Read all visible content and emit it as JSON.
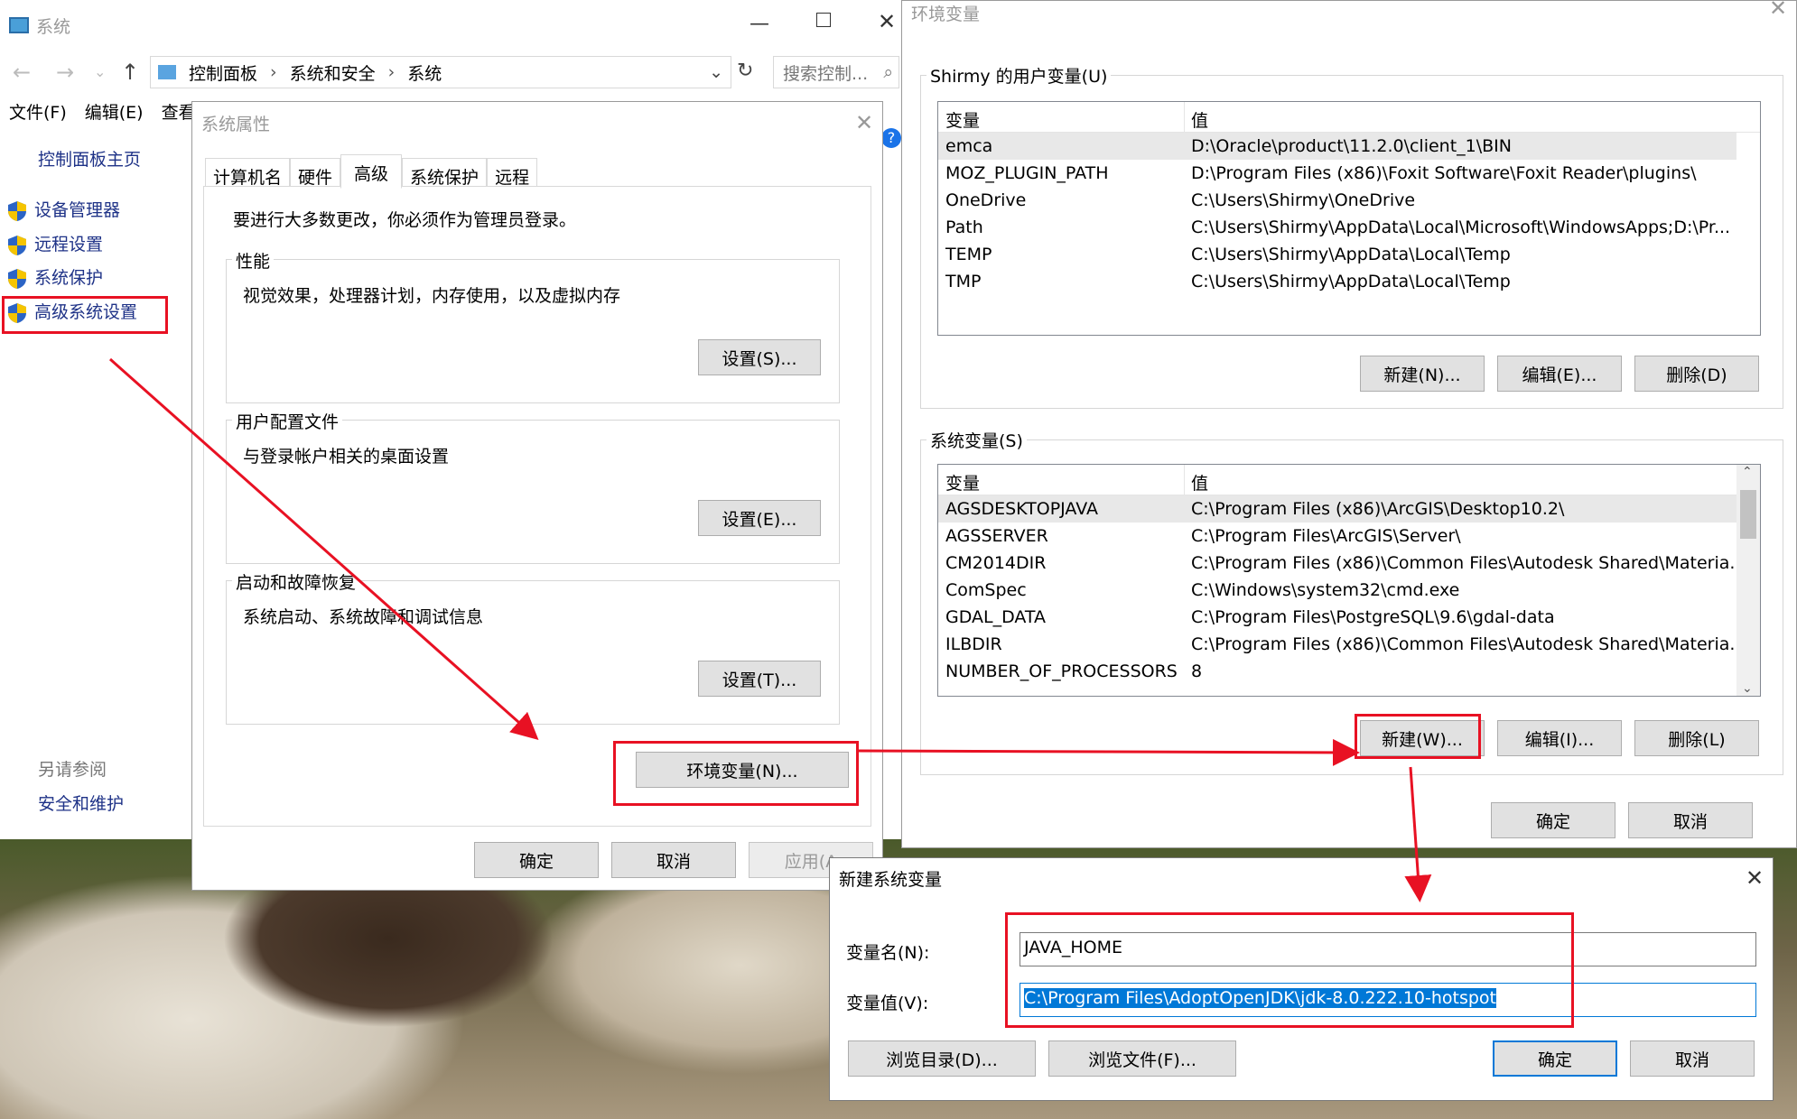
{
  "system_window": {
    "title": "系统",
    "address": [
      "控制面板",
      "系统和安全",
      "系统"
    ],
    "search_placeholder": "搜索控制...",
    "menu": [
      "文件(F)",
      "编辑(E)",
      "查看("
    ],
    "home_link": "控制面板主页",
    "links": [
      "设备管理器",
      "远程设置",
      "系统保护",
      "高级系统设置"
    ],
    "see_also_title": "另请参阅",
    "see_also": "安全和维护"
  },
  "sysprops": {
    "title": "系统属性",
    "tabs": [
      "计算机名",
      "硬件",
      "高级",
      "系统保护",
      "远程"
    ],
    "admin_note": "要进行大多数更改，你必须作为管理员登录。",
    "perf": {
      "title": "性能",
      "desc": "视觉效果，处理器计划，内存使用，以及虚拟内存",
      "button": "设置(S)..."
    },
    "profile": {
      "title": "用户配置文件",
      "desc": "与登录帐户相关的桌面设置",
      "button": "设置(E)..."
    },
    "startup": {
      "title": "启动和故障恢复",
      "desc": "系统启动、系统故障和调试信息",
      "button": "设置(T)..."
    },
    "env_button": "环境变量(N)...",
    "ok": "确定",
    "cancel": "取消",
    "apply": "应用(A"
  },
  "envvars": {
    "title": "环境变量",
    "user_group": "Shirmy 的用户变量(U)",
    "col_var": "变量",
    "col_val": "值",
    "user_vars": [
      {
        "name": "emca",
        "value": "D:\\Oracle\\product\\11.2.0\\client_1\\BIN"
      },
      {
        "name": "MOZ_PLUGIN_PATH",
        "value": "D:\\Program Files (x86)\\Foxit Software\\Foxit Reader\\plugins\\"
      },
      {
        "name": "OneDrive",
        "value": "C:\\Users\\Shirmy\\OneDrive"
      },
      {
        "name": "Path",
        "value": "C:\\Users\\Shirmy\\AppData\\Local\\Microsoft\\WindowsApps;D:\\Pr..."
      },
      {
        "name": "TEMP",
        "value": "C:\\Users\\Shirmy\\AppData\\Local\\Temp"
      },
      {
        "name": "TMP",
        "value": "C:\\Users\\Shirmy\\AppData\\Local\\Temp"
      }
    ],
    "user_buttons": [
      "新建(N)...",
      "编辑(E)...",
      "删除(D)"
    ],
    "sys_group": "系统变量(S)",
    "sys_vars": [
      {
        "name": "AGSDESKTOPJAVA",
        "value": "C:\\Program Files (x86)\\ArcGIS\\Desktop10.2\\"
      },
      {
        "name": "AGSSERVER",
        "value": "C:\\Program Files\\ArcGIS\\Server\\"
      },
      {
        "name": "CM2014DIR",
        "value": "C:\\Program Files (x86)\\Common Files\\Autodesk Shared\\Materia..."
      },
      {
        "name": "ComSpec",
        "value": "C:\\Windows\\system32\\cmd.exe"
      },
      {
        "name": "GDAL_DATA",
        "value": "C:\\Program Files\\PostgreSQL\\9.6\\gdal-data"
      },
      {
        "name": "ILBDIR",
        "value": "C:\\Program Files (x86)\\Common Files\\Autodesk Shared\\Materia..."
      },
      {
        "name": "NUMBER_OF_PROCESSORS",
        "value": "8"
      }
    ],
    "sys_buttons": [
      "新建(W)...",
      "编辑(I)...",
      "删除(L)"
    ],
    "ok": "确定",
    "cancel": "取消"
  },
  "newvar": {
    "title": "新建系统变量",
    "name_label": "变量名(N):",
    "name_value": "JAVA_HOME",
    "value_label": "变量值(V):",
    "value_value": "C:\\Program Files\\AdoptOpenJDK\\jdk-8.0.222.10-hotspot",
    "browse_dir": "浏览目录(D)...",
    "browse_file": "浏览文件(F)...",
    "ok": "确定",
    "cancel": "取消"
  },
  "accent_colors": {
    "highlight": "#e81123",
    "selection": "#0078d7"
  }
}
